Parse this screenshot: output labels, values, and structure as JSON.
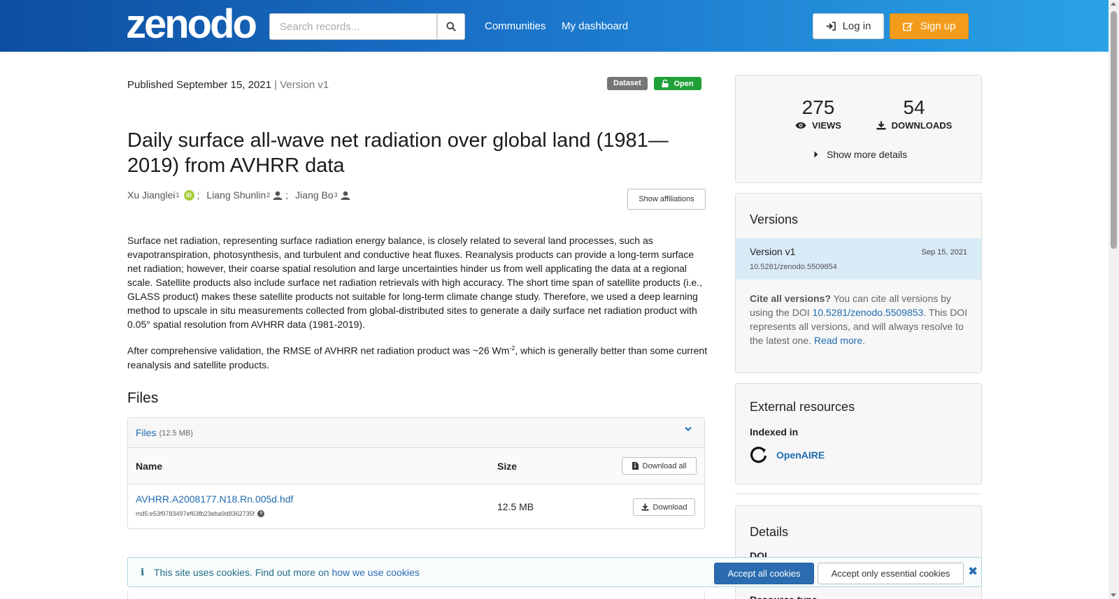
{
  "header": {
    "logo": "zenodo",
    "search_placeholder": "Search records...",
    "nav": [
      "Communities",
      "My dashboard"
    ],
    "login_label": "Log in",
    "signup_label": "Sign up"
  },
  "record": {
    "published_label": "Published September 15, 2021",
    "version_sep": "|",
    "version_label": "Version v1",
    "type_badge": "Dataset",
    "access_badge": "Open",
    "title": "Daily surface all-wave net radiation over global land (1981—2019) from AVHRR data",
    "authors": [
      {
        "name": "Xu Jianglei",
        "aff": "1",
        "icon": "orcid-icon"
      },
      {
        "name": "Liang Shunlin",
        "aff": "2",
        "icon": "user-icon"
      },
      {
        "name": "Jiang Bo",
        "aff": "3",
        "icon": "user-icon"
      }
    ],
    "show_affiliations": "Show affiliations",
    "abstract_p1": "Surface net radiation, representing surface radiation energy balance, is closely related to several land processes, such as evapotranspiration, photosynthesis, and turbulent and conductive heat fluxes. Reanalysis products can provide a long-term surface net radiation; however, their coarse spatial resolution and large uncertainties hinder us from well applicating the data at a regional scale. Satellite products also include surface net radiation retrievals with high accuracy. The short time span of satellite products (i.e., GLASS product) makes these satellite products not suitable for long-term climate change study. Therefore, we used a deep learning method to upscale in situ measurements collected from global-distributed sites to generate a daily surface net radiation product with 0.05° spatial resolution from AVHRR data (1981-2019).",
    "abstract_p2_a": "After comprehensive validation, the RMSE of AVHRR net radiation product was ~26 Wm",
    "abstract_p2_sup": "-2",
    "abstract_p2_b": ", which is generally better than some current reanalysis and satellite products."
  },
  "files": {
    "heading": "Files",
    "panel_label": "Files",
    "panel_size": "(12.5 MB)",
    "col_name": "Name",
    "col_size": "Size",
    "download_all": "Download all",
    "rows": [
      {
        "name": "AVHRR.A2008177.N18.Rn.005d.hdf",
        "md5": "md5:e53f9783497ef63fb23eba9d8362735f",
        "size": "12.5 MB",
        "download": "Download"
      }
    ]
  },
  "sidebar": {
    "views_count": "275",
    "views_label": "VIEWS",
    "downloads_count": "54",
    "downloads_label": "DOWNLOADS",
    "show_more": "Show more details",
    "versions_heading": "Versions",
    "version_name": "Version v1",
    "version_date": "Sep 15, 2021",
    "version_doi": "10.5281/zenodo.5509854",
    "cite_bold": "Cite all versions?",
    "cite_text1": " You can cite all versions by using the DOI ",
    "cite_doi": "10.5281/zenodo.5509853",
    "cite_text2": ". This DOI represents all versions, and will always resolve to the latest one. ",
    "cite_readmore": "Read more",
    "cite_end": ".",
    "external_heading": "External resources",
    "indexed_in": "Indexed in",
    "openaire": "OpenAIRE",
    "details_heading": "Details",
    "details_doi": "DOI",
    "details_resource_type": "Resource type"
  },
  "cookie": {
    "text": "This site uses cookies. Find out more on ",
    "link": "how we use cookies",
    "accept_all": "Accept all cookies",
    "accept_essential": "Accept only essential cookies"
  },
  "colors": {
    "header_start": "#0d4ea0",
    "header_end": "#2aa3e8",
    "signup": "#f39c1b",
    "open_badge": "#21a038",
    "link": "#1f6bb0"
  }
}
